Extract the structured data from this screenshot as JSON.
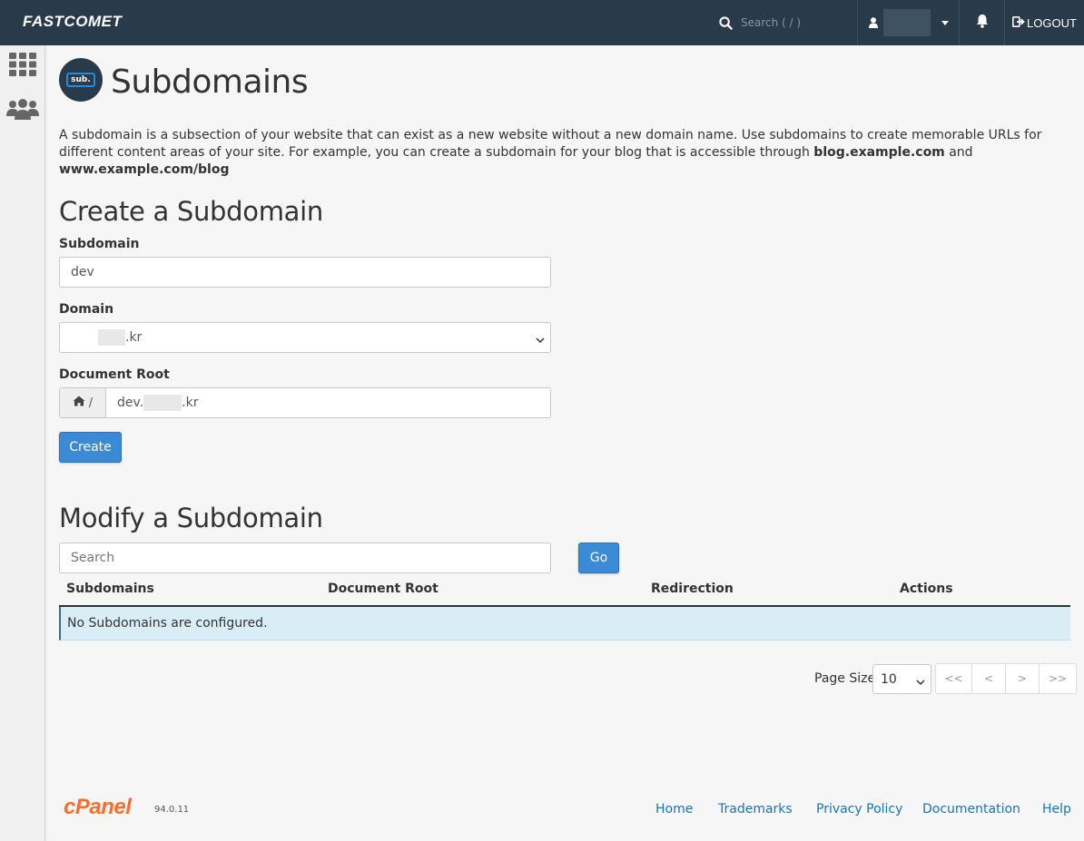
{
  "topbar": {
    "brand": "FASTCOMET",
    "search_placeholder": "Search ( / )",
    "logout_label": "LOGOUT"
  },
  "header": {
    "icon_label": "sub.",
    "title": "Subdomains"
  },
  "intro": {
    "text_1": "A subdomain is a subsection of your website that can exist as a new website without a new domain name. Use subdomains to create memorable URLs for different content areas of your site. For example, you can create a subdomain for your blog that is accessible through ",
    "bold_1": "blog.example.com",
    "text_2": " and ",
    "bold_2": "www.example.com/blog"
  },
  "create": {
    "heading": "Create a Subdomain",
    "subdomain_label": "Subdomain",
    "subdomain_value": "dev",
    "domain_label": "Domain",
    "domain_value_suffix": ".kr",
    "docroot_label": "Document Root",
    "docroot_addon": "/",
    "docroot_prefix": "dev.",
    "docroot_suffix": ".kr",
    "create_button": "Create"
  },
  "modify": {
    "heading": "Modify a Subdomain",
    "search_placeholder": "Search",
    "go_button": "Go",
    "columns": [
      "Subdomains",
      "Document Root",
      "Redirection",
      "Actions"
    ],
    "empty_message": "No Subdomains are configured.",
    "page_size_label": "Page Size",
    "page_size_value": "10",
    "pager": [
      "<<",
      "<",
      ">",
      ">>"
    ]
  },
  "footer": {
    "logo": "cPanel",
    "version": "94.0.11",
    "links": [
      "Home",
      "Trademarks",
      "Privacy Policy",
      "Documentation",
      "Help"
    ]
  },
  "colors": {
    "topbar_bg": "#293a4a",
    "primary_button": "#3a8ad6",
    "info_row": "#d9edf7",
    "cpanel_orange": "#ff6c2c",
    "link": "#1a73b8"
  }
}
